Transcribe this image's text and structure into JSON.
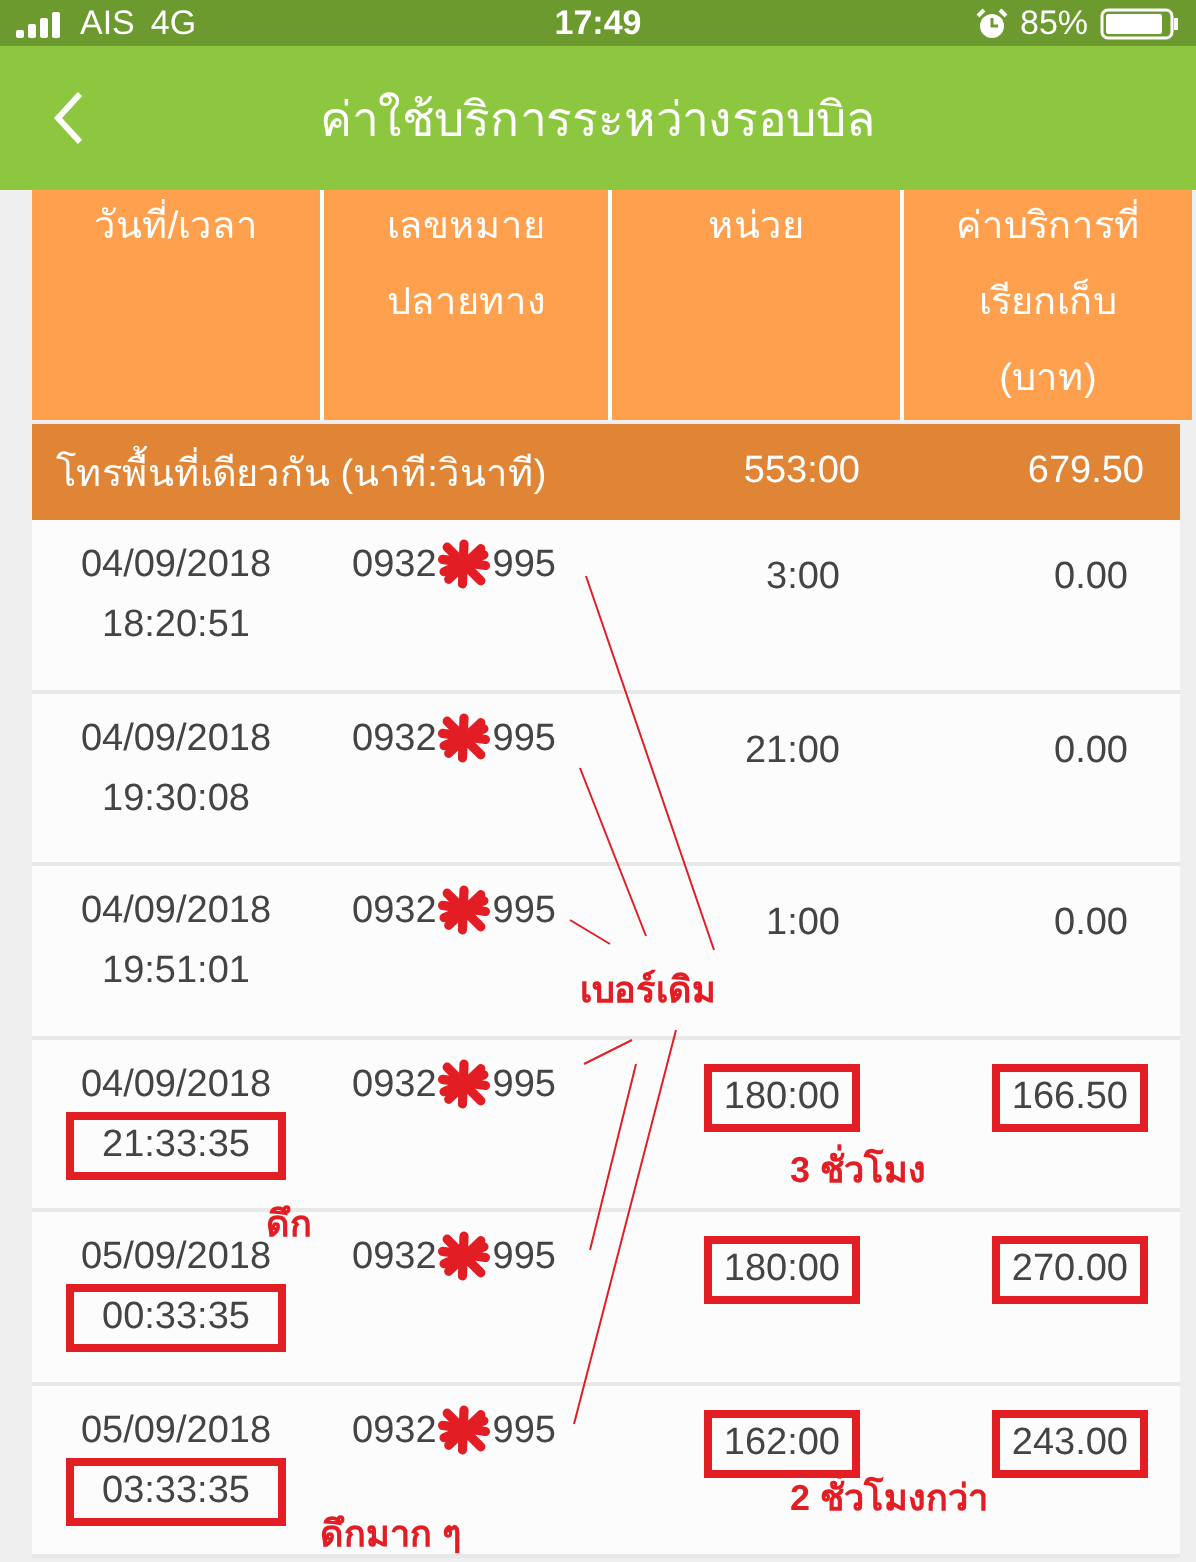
{
  "status_bar": {
    "carrier": "AIS",
    "network": "4G",
    "time": "17:49",
    "battery": "85%"
  },
  "header": {
    "title": "ค่าใช้บริการระหว่างรอบบิล"
  },
  "table": {
    "columns": [
      "วันที่/เวลา",
      "เลขหมาย\nปลายทาง",
      "หน่วย",
      "ค่าบริการที่\nเรียกเก็บ\n(บาท)"
    ],
    "summary": {
      "label": "โทรพื้นที่เดียวกัน (นาที:วินาที)",
      "units": "553:00",
      "charge": "679.50"
    },
    "rows": [
      {
        "date": "04/09/2018",
        "time": "18:20:51",
        "number_start": "0932",
        "number_end": "995",
        "units": "3:00",
        "charge": "0.00",
        "time_marked": false,
        "units_marked": false,
        "charge_marked": false
      },
      {
        "date": "04/09/2018",
        "time": "19:30:08",
        "number_start": "0932",
        "number_end": "995",
        "units": "21:00",
        "charge": "0.00",
        "time_marked": false,
        "units_marked": false,
        "charge_marked": false
      },
      {
        "date": "04/09/2018",
        "time": "19:51:01",
        "number_start": "0932",
        "number_end": "995",
        "units": "1:00",
        "charge": "0.00",
        "time_marked": false,
        "units_marked": false,
        "charge_marked": false
      },
      {
        "date": "04/09/2018",
        "time": "21:33:35",
        "number_start": "0932",
        "number_end": "995",
        "units": "180:00",
        "charge": "166.50",
        "time_marked": true,
        "units_marked": true,
        "charge_marked": true
      },
      {
        "date": "05/09/2018",
        "time": "00:33:35",
        "number_start": "0932",
        "number_end": "995",
        "units": "180:00",
        "charge": "270.00",
        "time_marked": true,
        "units_marked": true,
        "charge_marked": true
      },
      {
        "date": "05/09/2018",
        "time": "03:33:35",
        "number_start": "0932",
        "number_end": "995",
        "units": "162:00",
        "charge": "243.00",
        "time_marked": true,
        "units_marked": true,
        "charge_marked": true
      }
    ]
  },
  "annotations": [
    {
      "text": "เบอร์เดิม"
    },
    {
      "text": "3 ชั่วโมง"
    },
    {
      "text": "ดึก"
    },
    {
      "text": "ดึกมาก ๆ"
    },
    {
      "text": "2 ชั่วโมงกว่า"
    }
  ]
}
